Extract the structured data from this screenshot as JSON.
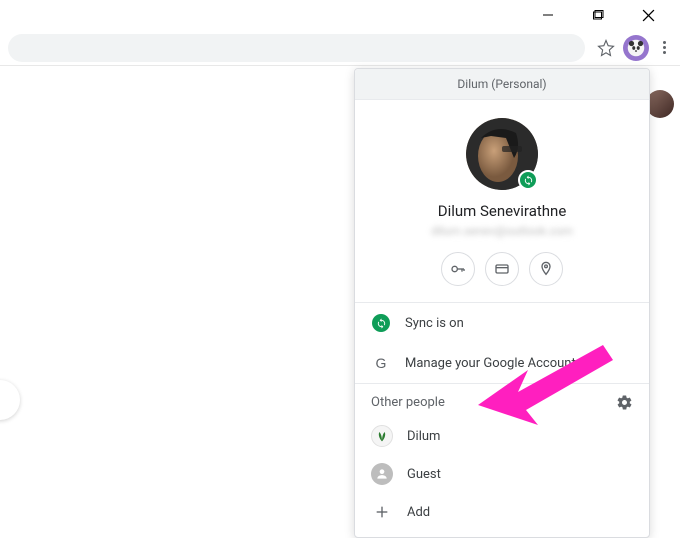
{
  "window": {
    "minimize": "minimize",
    "maximize": "maximize",
    "close": "close"
  },
  "toolbar": {
    "bookmark": "bookmark"
  },
  "profile_panel": {
    "header": "Dilum (Personal)",
    "display_name": "Dilum Senevirathne",
    "email_blurred": "dilum.senev@outlook.com",
    "quick_actions": {
      "passwords": "passwords",
      "payments": "payments",
      "addresses": "addresses"
    },
    "sync_label": "Sync is on",
    "manage_label": "Manage your Google Account",
    "other_people_header": "Other people",
    "settings": "settings",
    "people": [
      {
        "name": "Dilum"
      },
      {
        "name": "Guest"
      }
    ],
    "add_label": "Add"
  },
  "annotation": {
    "color": "#ff1fbf"
  }
}
